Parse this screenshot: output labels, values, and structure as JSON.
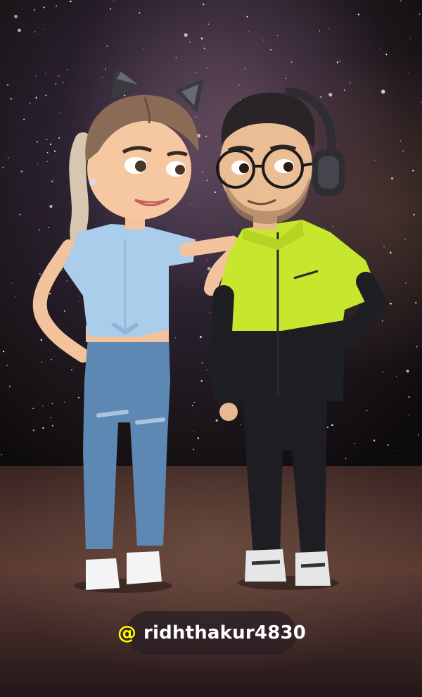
{
  "sticker": {
    "at_symbol": "@",
    "username": "ridhthakur4830"
  },
  "colors": {
    "mention_at": "#FFFC00",
    "mention_text": "#FFFFFF",
    "jacket": "#C7E62E",
    "jeans": "#5E88B4",
    "shirt": "#A9CDEB"
  },
  "icons": [
    "at-icon",
    "headphones-icon",
    "glasses-icon",
    "cat-ear-headband-icon"
  ]
}
